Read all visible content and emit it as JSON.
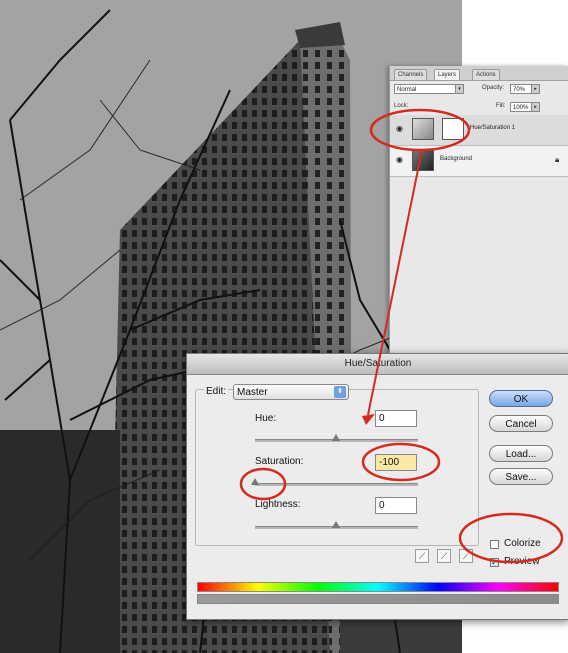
{
  "layers_panel": {
    "tabs": [
      "Channels",
      "Layers",
      "Actions"
    ],
    "blend_mode": "Normal",
    "opacity_label": "Opacity:",
    "opacity_value": "70%",
    "lock_label": "Lock:",
    "fill_label": "Fill:",
    "fill_value": "100%",
    "layers": [
      {
        "name": "Hue/Saturation 1",
        "visible": true
      },
      {
        "name": "Background",
        "visible": true,
        "locked": true
      }
    ]
  },
  "dialog": {
    "title": "Hue/Saturation",
    "edit_label": "Edit:",
    "edit_value": "Master",
    "hue_label": "Hue:",
    "hue_value": "0",
    "saturation_label": "Saturation:",
    "saturation_value": "-100",
    "lightness_label": "Lightness:",
    "lightness_value": "0",
    "buttons": {
      "ok": "OK",
      "cancel": "Cancel",
      "load": "Load...",
      "save": "Save..."
    },
    "colorize_label": "Colorize",
    "colorize_checked": false,
    "preview_label": "Preview",
    "preview_checked": true
  },
  "annotation_color": "#d42a1f",
  "icons": [
    "eye-icon",
    "lock-icon",
    "eyedropper-icon",
    "eyedropper-plus-icon",
    "eyedropper-minus-icon"
  ]
}
